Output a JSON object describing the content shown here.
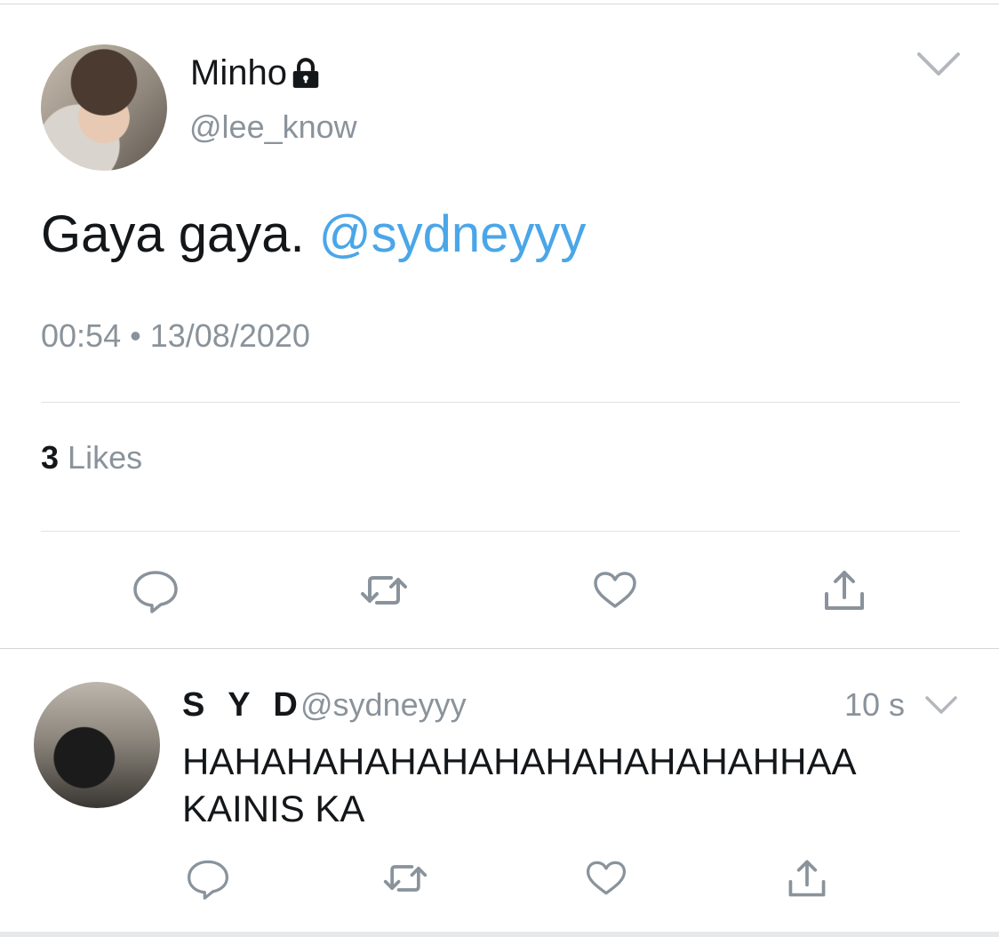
{
  "tweet": {
    "author_name": "Minho",
    "handle": "@lee_know",
    "text": "Gaya gaya.",
    "mention": "@sydneyyy",
    "time": "00:54",
    "separator": "•",
    "date": "13/08/2020",
    "likes_count": "3",
    "likes_label": "Likes",
    "protected_icon": "lock-icon",
    "menu_icon": "chevron-down-icon"
  },
  "reply": {
    "author_name": "S Y D",
    "handle": "@sydneyyy",
    "time": "10 s",
    "text_line1": "HAHAHAHAHAHAHAHAHAHAHAHHAA",
    "text_line2": "KAINIS KA"
  },
  "actions": [
    "reply-icon",
    "retweet-icon",
    "like-icon",
    "share-icon"
  ],
  "colors": {
    "text": "#14171a",
    "secondary": "#8a939b",
    "link": "#4aa6e8",
    "icon": "#8a939b",
    "divider": "#dfe2e5"
  }
}
